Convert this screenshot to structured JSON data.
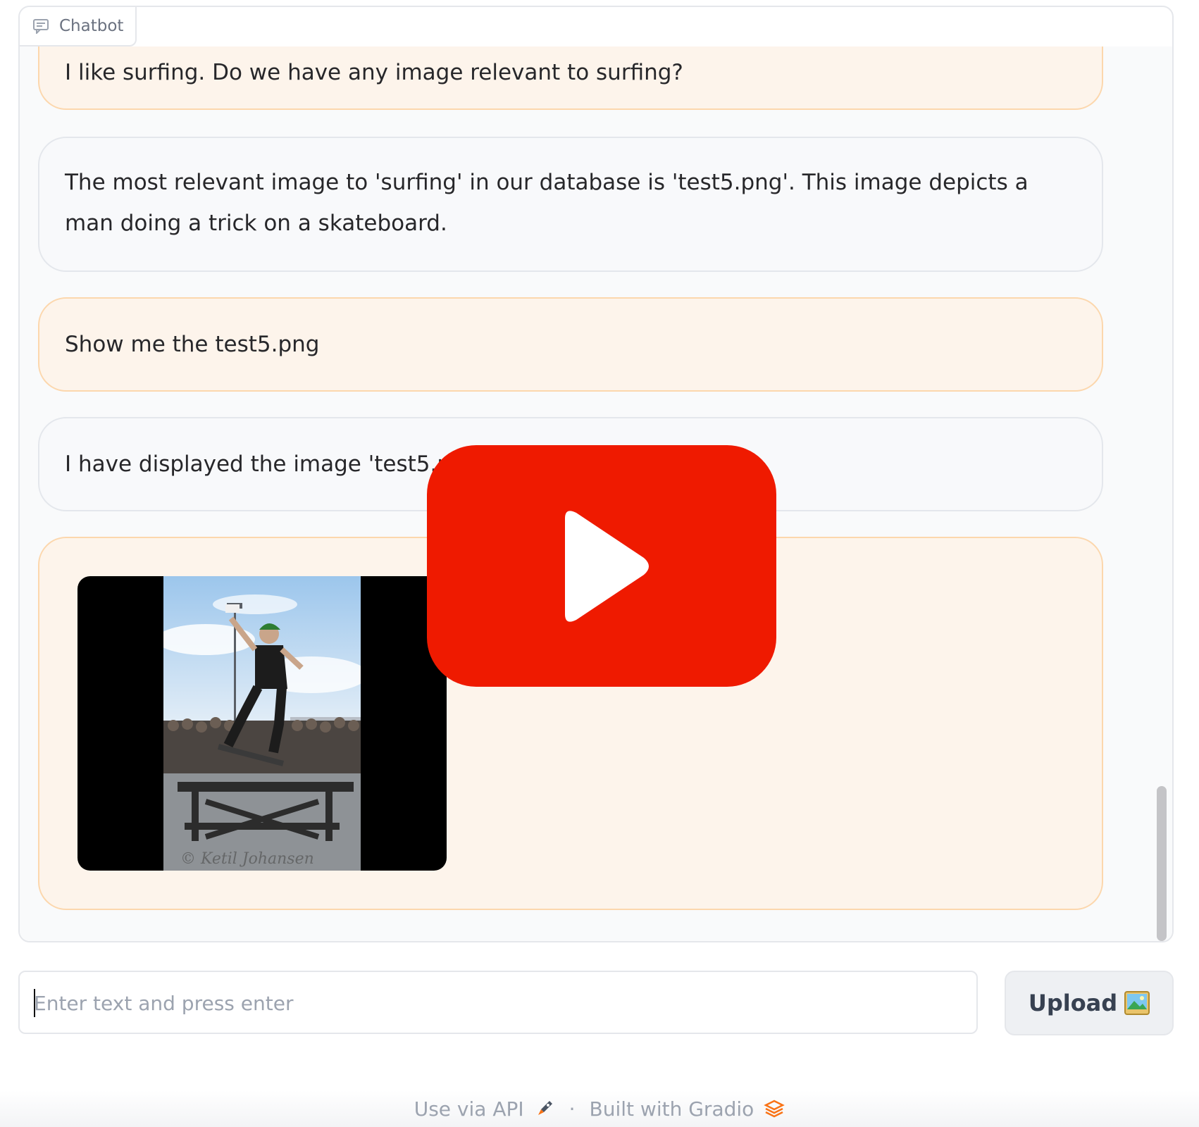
{
  "chatbot": {
    "label": "Chatbot",
    "messages": [
      {
        "role": "user",
        "text": "I like surfing. Do we have any image relevant to surfing?"
      },
      {
        "role": "bot",
        "text": "The most relevant image to 'surfing' in our database is 'test5.png'. This image depicts a man doing a trick on a skateboard."
      },
      {
        "role": "user",
        "text": "Show me the test5.png"
      },
      {
        "role": "bot",
        "text": "I have displayed the image 'test5.png'."
      }
    ],
    "image_watermark": "© Ketil Johansen"
  },
  "input": {
    "placeholder": "Enter text and press enter",
    "value": ""
  },
  "upload_button": {
    "label": "Upload",
    "icon": "picture-icon"
  },
  "footer": {
    "api_link": "Use via API",
    "separator": "·",
    "built_with": "Built with Gradio"
  },
  "colors": {
    "user_bubble": "#fdf4eb",
    "user_border": "#fcd7ad",
    "bot_bubble": "#f8f9fb",
    "play_button": "#ef1a00",
    "gradio_orange": "#f97316"
  }
}
